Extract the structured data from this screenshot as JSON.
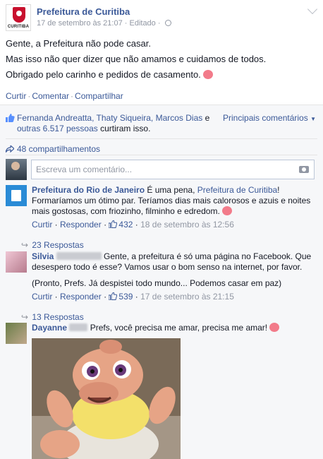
{
  "post": {
    "page_name": "Prefeitura de Curitiba",
    "logo_text": "CURITIBA",
    "date": "17 de setembro às 21:07",
    "edited": "Editado",
    "lines": [
      "Gente, a Prefeitura não pode casar.",
      "Mas isso não quer dizer que não amamos e cuidamos de todos.",
      "Obrigado pelo carinho e pedidos de casamento."
    ],
    "actions": {
      "like": "Curtir",
      "comment": "Comentar",
      "share": "Compartilhar"
    }
  },
  "likes": {
    "names": "Fernanda Andreatta, Thaty Siqueira, Marcos Dias",
    "and": "e",
    "others": "outras 6.517 pessoas",
    "suffix": "curtiram isso.",
    "top_comments": "Principais comentários"
  },
  "shares": "48 compartilhamentos",
  "comment_box": {
    "placeholder": "Escreva um comentário..."
  },
  "comments": [
    {
      "author": "Prefeitura do Rio de Janeiro",
      "text_before": "É uma pena,",
      "mention": "Prefeitura de Curitiba",
      "text_after": "! Formaríamos um ótimo par. Teríamos dias mais calorosos e azuis e noites mais gostosas, com friozinho, filminho e edredom.",
      "like_label": "Curtir",
      "reply_label": "Responder",
      "like_count": "432",
      "date": "18 de setembro às 12:56",
      "replies": "23 Respostas"
    },
    {
      "author": "Silvia",
      "text": "Gente, a prefeitura é só uma página no Facebook. Que desespero todo é esse? Vamos usar o bom senso na internet, por favor.",
      "text2": "(Pronto, Prefs. Já despistei todo mundo... Podemos casar em paz)",
      "like_label": "Curtir",
      "reply_label": "Responder",
      "like_count": "539",
      "date": "17 de setembro às 21:15",
      "replies": "13 Respostas"
    },
    {
      "author": "Dayanne",
      "text": "Prefs, você precisa me amar, precisa me amar!"
    }
  ],
  "colors": {
    "link": "#3b5998",
    "muted": "#9197a3",
    "heart": "#f27b8a"
  }
}
